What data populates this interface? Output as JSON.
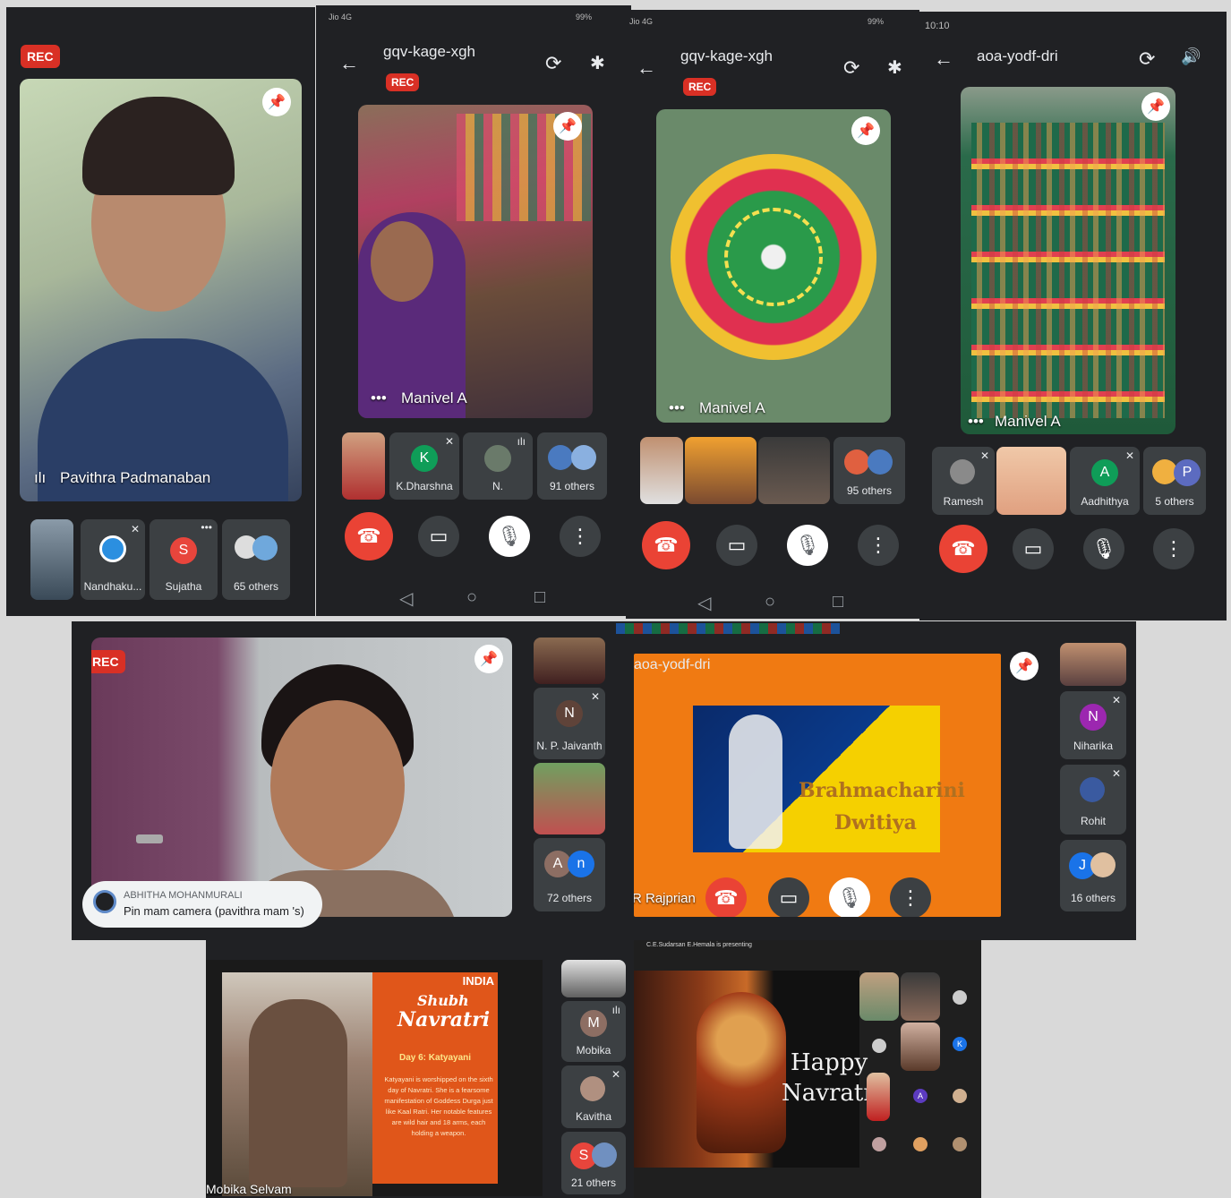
{
  "rec_label": "REC",
  "panel1": {
    "speaker": "Pavithra Padmanaban",
    "tiles": [
      "Nandhaku...",
      "Sujatha",
      "65 others"
    ],
    "avatar_letter": "S",
    "avatar_color": "#e8453c"
  },
  "panel2": {
    "meeting_code": "gqv-kage-xgh",
    "status_left": "Jio 4G",
    "status_right": "99%",
    "speaker": "Manivel A",
    "tiles": [
      "K.Dharshna",
      "N.",
      "91 others"
    ],
    "avatar_letter": "K",
    "avatar_color": "#0f9d58"
  },
  "panel3": {
    "meeting_code": "gqv-kage-xgh",
    "status_left": "Jio 4G",
    "status_right": "99%",
    "speaker": "Manivel A",
    "tiles": [
      "95 others"
    ]
  },
  "panel4": {
    "meeting_code": "aoa-yodf-dri",
    "status_left": "10:10",
    "speaker": "Manivel A",
    "tiles": [
      "Ramesh",
      "Aadhithya",
      "5 others"
    ],
    "avatar_a": "A",
    "avatar_p": "P",
    "avatar_a_color": "#0f9d58",
    "avatar_p_color": "#5c6bc0"
  },
  "panel5": {
    "chat_sender": "ABHITHA MOHANMURALI",
    "chat_message": "Pin mam camera (pavithra mam 's)",
    "tiles": [
      "N. P. Jaivanth",
      "72 others"
    ],
    "avatar_n": "N",
    "avatar_a": "A",
    "avatar_small_n": "n"
  },
  "panel6": {
    "meeting_code": "aoa-yodf-dri",
    "slide_line1": "Brahmacharini",
    "slide_line2": "Dwitiya",
    "presenter": "R Rajprian",
    "tiles": [
      "Niharika",
      "Rohit",
      "16 others"
    ],
    "avatar_n": "N",
    "avatar_j": "J"
  },
  "panel7": {
    "brand": "INDIA",
    "slide_title1": "Shubh",
    "slide_title2": "Navratri",
    "slide_subtitle": "Day 6: Katyayani",
    "slide_body": "Katyayani is worshipped on the sixth day of Navratri. She is a fearsome manifestation of Goddess Durga just like Kaal Ratri. Her notable features are wild hair and 18 arms, each holding a weapon.",
    "presenter": "Mobika Selvam",
    "tiles": [
      "Mobika",
      "Kavitha",
      "21 others"
    ],
    "avatar_m": "M",
    "avatar_s": "S"
  },
  "panel8": {
    "presenting_label": "C.E.Sudarsan E.Hemala is presenting",
    "greeting1": "Happy",
    "greeting2": "Navratri",
    "avatar_k": "K",
    "avatar_a": "A"
  },
  "icons": {
    "pin": "📌",
    "end_call": "☎",
    "camera": "▭",
    "mic_off": "🎙",
    "more": "⋮",
    "back": "←",
    "bluetooth": "✱",
    "sound": "🔊",
    "sync": "⟳"
  }
}
